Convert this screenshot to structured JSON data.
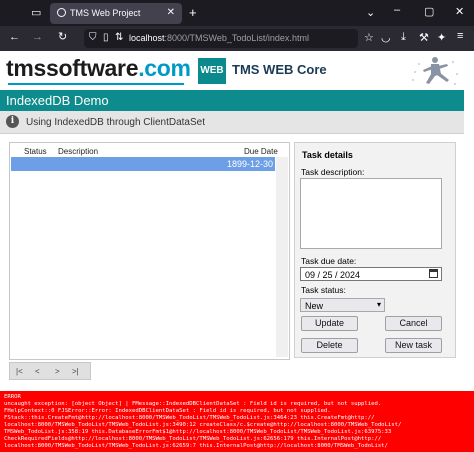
{
  "browser": {
    "tab_title": "TMS Web Project",
    "url_host": "localhost",
    "url_rest": ":8000/TMSWeb_TodoList/index.html"
  },
  "header": {
    "logo_name": "tmssoftware",
    "logo_tld": ".com",
    "web_badge": "WEB",
    "product": "TMS WEB Core"
  },
  "app": {
    "title": "IndexedDB Demo",
    "info": "Using IndexedDB through ClientDataSet"
  },
  "grid": {
    "columns": [
      "Status",
      "Description",
      "Due Date"
    ],
    "rows": [
      {
        "status": "",
        "description": "",
        "due_date": "1899-12-30"
      }
    ]
  },
  "pager": {
    "first": "|<",
    "prev": "<",
    "next": ">",
    "last": ">|"
  },
  "details": {
    "title": "Task details",
    "desc_label": "Task description:",
    "due_label": "Task due date:",
    "due_value": "09 / 25 / 2024",
    "status_label": "Task status:",
    "status_value": "New",
    "buttons": {
      "update": "Update",
      "cancel": "Cancel",
      "delete": "Delete",
      "new_task": "New task"
    }
  },
  "error": {
    "lines": [
      "ERROR",
      "uncaught exception: [object Object] | FMessage::IndexedDBClientDataSet : Field id is required, but not supplied.",
      "FHelpContext::0 FJSError::Error: IndexedDBClientDataSet : Field id is required, but not supplied.",
      "FStack::this.CreateFmt@http://localhost:8000/TMSWeb_TodoList/TMSWeb_TodoList.js:3464:23 this.CreateFmt@http://",
      "localhost:8000/TMSWeb_TodoList/TMSWeb_TodoList.js:3490:12 createClass/c.$create@http://localhost:8000/TMSWeb_TodoList/",
      "TMSWeb_TodoList.js:358:19 this.DatabaseErrorFmt$1@http://localhost:8000/TMSWeb_TodoList/TMSWeb_TodoList.js:63975:33",
      "CheckRequiredFields@http://localhost:8000/TMSWeb_TodoList/TMSWeb_TodoList.js:62656:179 this.InternalPost@http://",
      "localhost:8000/TMSWeb_TodoList/TMSWeb_TodoList.js:62659:7 this.InternalPost@http://localhost:8000/TMSWeb_TodoList/"
    ]
  },
  "colors": {
    "banner": "#0e8b8d",
    "selected_row": "#6c9fe6",
    "error_bg": "#ff0000"
  }
}
